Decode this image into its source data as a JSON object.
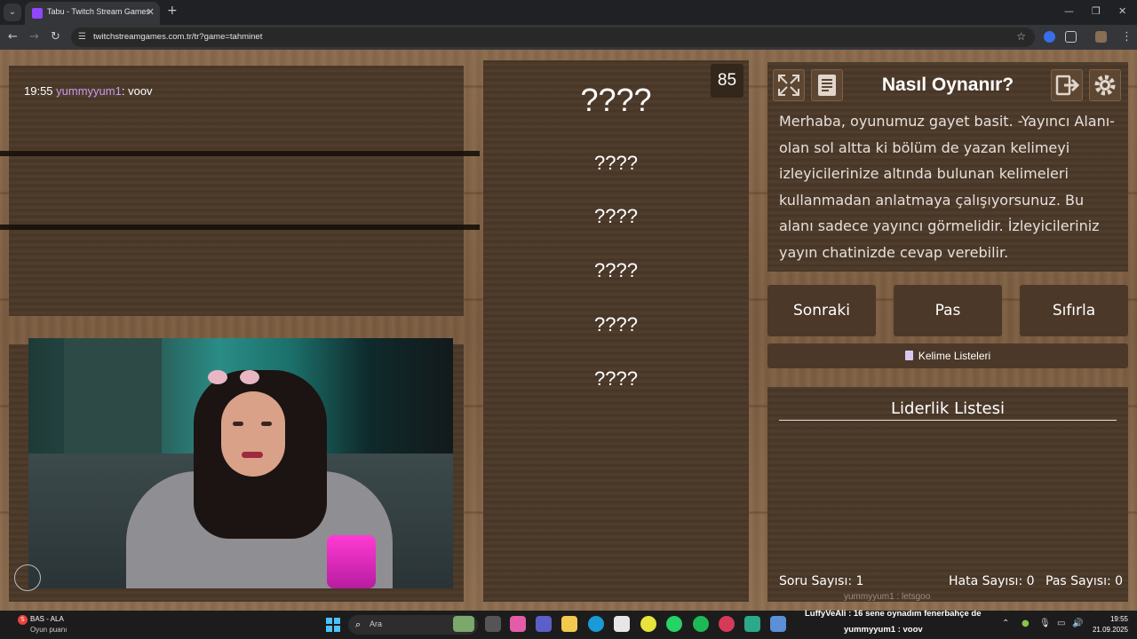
{
  "browser": {
    "tab_title": "Tabu - Twitch Stream Games",
    "url": "twitchstreamgames.com.tr/tr?game=tahminet"
  },
  "chat": {
    "time": "19:55",
    "user": "yummyyum1",
    "message": ": voov"
  },
  "card": {
    "timer": "85",
    "main_word": "????",
    "taboo_words": [
      "????",
      "????",
      "????",
      "????",
      "????"
    ]
  },
  "help": {
    "title": "Nasıl Oynanır?",
    "description": "Merhaba, oyunumuz gayet basit. -Yayıncı Alanı- olan sol altta ki bölüm de yazan kelimeyi izleyicilerinize altında bulunan kelimeleri kullanmadan anlatmaya çalışıyorsunuz. Bu alanı sadece yayıncı görmelidir. İzleyicileriniz yayın chatinizde cevap verebilir."
  },
  "actions": {
    "next": "Sonraki",
    "pass": "Pas",
    "reset": "Sıfırla",
    "word_lists": "Kelime Listeleri"
  },
  "leaderboard": {
    "title": "Liderlik Listesi",
    "question_count": "Soru Sayısı: 1",
    "error_count": "Hata Sayısı: 0",
    "pass_count": "Pas Sayısı: 0"
  },
  "stream_overlay": {
    "ghost_line": "yummyyum1 : letsgoo",
    "line1": "LuffyVeAli : 16 sene oynadım fenerbahçe de",
    "line2": "yummyyum1 : voov"
  },
  "taskbar": {
    "stock_name": "BAS - ALA",
    "stock_sub": "Oyun puanı",
    "search_placeholder": "Ara",
    "time": "19:55",
    "date": "21.09.2025"
  },
  "colors": {
    "wood": "#7b5c40",
    "panel": "#4b3828",
    "chat_user": "#c89cf0"
  }
}
